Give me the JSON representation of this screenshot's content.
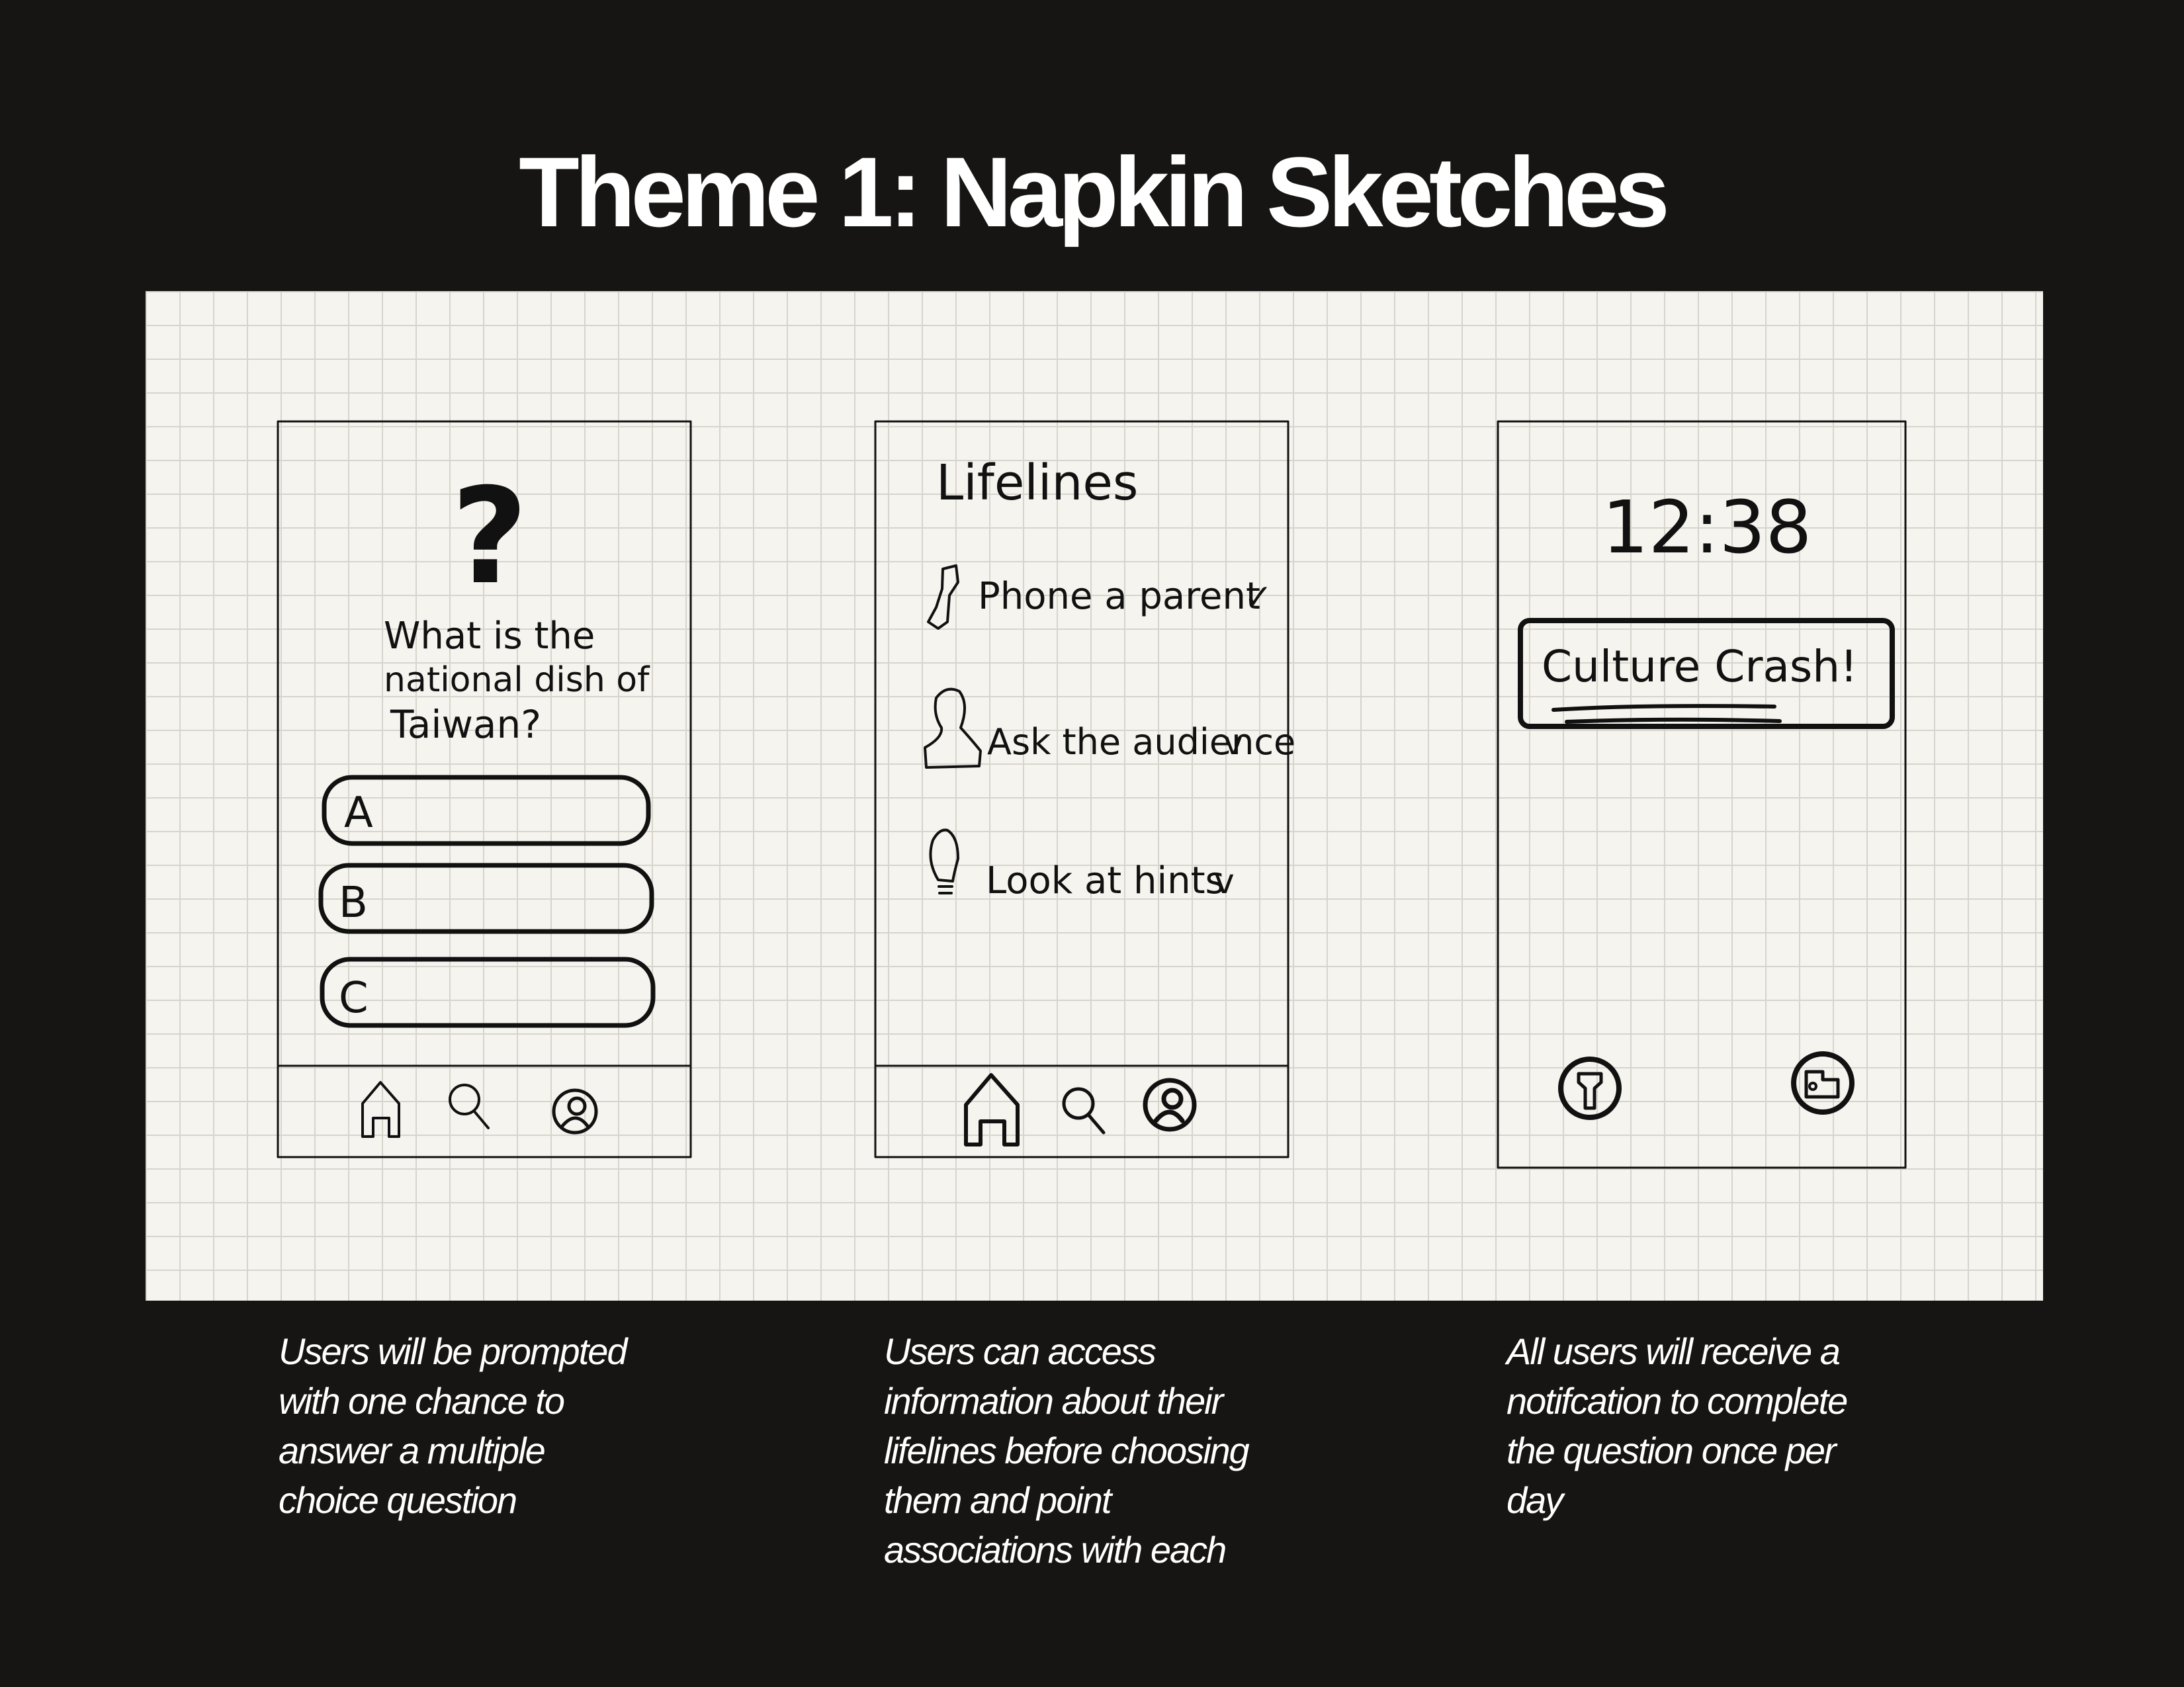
{
  "title": "Theme 1: Napkin Sketches",
  "colors": {
    "background": "#161513",
    "paper": "#f6f4ee",
    "grid": "#d6d4cd",
    "ink": "#111111",
    "text": "#ffffff"
  },
  "sketches": [
    {
      "question_mark": "?",
      "question_lines": [
        "What is the",
        "national dish of",
        "Taiwan?"
      ],
      "options": [
        "A",
        "B",
        "C"
      ],
      "nav_icons": [
        "home-icon",
        "search-icon",
        "profile-icon"
      ]
    },
    {
      "heading": "Lifelines",
      "items": [
        {
          "icon": "phone-icon",
          "label": "Phone a parent",
          "check": "✓"
        },
        {
          "icon": "person-icon",
          "label": "Ask the audience",
          "check": "v"
        },
        {
          "icon": "lightbulb-icon",
          "label": "Look at hints",
          "check": "v"
        }
      ],
      "nav_icons": [
        "home-icon",
        "search-icon",
        "profile-icon"
      ]
    },
    {
      "time": "12:38",
      "notification_title": "Culture Crash!",
      "lock_icons": [
        "flashlight-icon",
        "camera-icon"
      ]
    }
  ],
  "captions": [
    [
      "Users will be prompted",
      "with one chance to",
      "answer a multiple",
      "choice question"
    ],
    [
      "Users can access",
      "information about their",
      "lifelines before choosing",
      "them and point",
      "associations with each"
    ],
    [
      "All users will receive a",
      "notifcation to complete",
      "the question once per",
      "day"
    ]
  ]
}
